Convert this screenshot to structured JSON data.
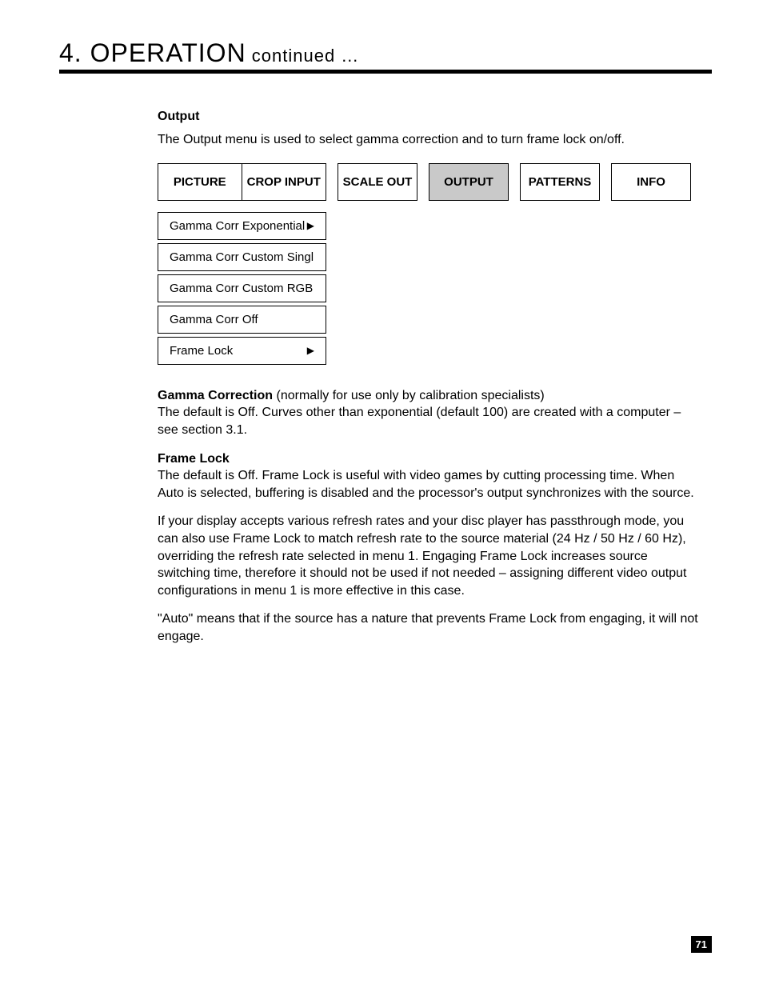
{
  "header": {
    "title_main": "4. OPERATION",
    "title_sub": " continued …"
  },
  "section_heading": "Output",
  "intro_text": "The Output menu is used to select gamma correction and to turn frame lock on/off.",
  "tabs": {
    "picture": "PICTURE",
    "crop_input": "CROP INPUT",
    "scale_out": "SCALE OUT",
    "output": "OUTPUT",
    "patterns": "PATTERNS",
    "info": "INFO"
  },
  "menu_items": [
    {
      "label": "Gamma Corr Exponential",
      "has_arrow": true
    },
    {
      "label": "Gamma Corr Custom Singl",
      "has_arrow": false
    },
    {
      "label": "Gamma Corr Custom RGB",
      "has_arrow": false
    },
    {
      "label": "Gamma Corr Off",
      "has_arrow": false
    },
    {
      "label": "Frame Lock",
      "has_arrow": true
    }
  ],
  "body": {
    "gamma_label": "Gamma Correction",
    "gamma_note": " (normally for use only by calibration specialists)",
    "gamma_text": "The default is Off. Curves other than exponential (default 100) are created with a computer – see section 3.1.",
    "framelock_label": "Frame Lock",
    "framelock_text": "The default is Off. Frame Lock is useful with video games by cutting processing time. When Auto is selected, buffering is disabled and the processor's output synchronizes with the source.",
    "para2": "If your display accepts various refresh rates and your disc player has passthrough mode, you can also use Frame Lock to match refresh rate to the source material (24 Hz / 50 Hz / 60 Hz), overriding the refresh rate selected in menu 1. Engaging Frame Lock increases source switching time, therefore it should not be used if not needed – assigning different video output configurations in menu 1 is more effective in this case.",
    "para3": "\"Auto\" means that if the source has a nature that prevents Frame Lock from engaging, it will not engage."
  },
  "page_number": "71",
  "arrow_glyph": "▶"
}
